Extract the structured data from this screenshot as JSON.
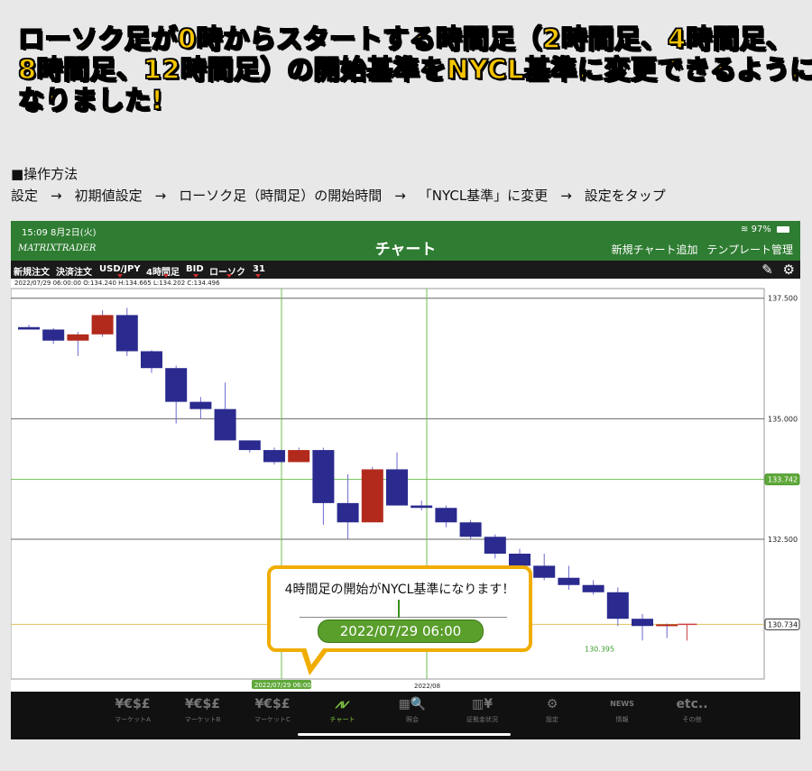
{
  "headline": {
    "line1": "ローソク足が0時からスタートする時間足（2時間足、4時間足、",
    "line2": "8時間足、12時間足）の開始基準をNYCL基準に変更できるように",
    "line3": "なりました!"
  },
  "ops": {
    "title": "■操作方法",
    "steps": [
      "設定",
      "初期値設定",
      "ローソク足（時間足）の開始時間",
      "「NYCL基準」に変更",
      "設定をタップ"
    ],
    "arrow": "→"
  },
  "statusbar": {
    "time": "15:09  8月2日(火)",
    "battery": "97%"
  },
  "navbar": {
    "logo": "MATRIXTRADER",
    "title": "チャート",
    "new_chart": "新規チャート追加",
    "template": "テンプレート管理"
  },
  "toolbar": {
    "new_order": "新規注文",
    "close_order": "決済注文",
    "pair": "USD/JPY",
    "timeframe": "4時間足",
    "side": "BID",
    "chart_type": "ローソク",
    "count": "31"
  },
  "ohlc": "2022/07/29 06:00:00   O:134.240  H:134.665  L:134.202  C:134.496",
  "chart_data": {
    "type": "candlestick",
    "ylim": [
      129.6,
      137.7
    ],
    "y_ticks": [
      137.5,
      135.0,
      132.5
    ],
    "y_tick_labels": [
      "137.500",
      "135.000",
      "132.500"
    ],
    "current_price": "130.734",
    "crosshair_price": "133.742",
    "low_label": "130.395",
    "x_labels": [
      "2022/07/29 06:00",
      "2022/08"
    ],
    "colors": {
      "up": "#b22a1c",
      "down": "#2a2a8f",
      "grid": "#666666",
      "cross": "#6fbf4f",
      "price_line": "#e0c060"
    },
    "candles": [
      {
        "o": 136.9,
        "h": 136.95,
        "l": 136.85,
        "c": 136.85
      },
      {
        "o": 136.85,
        "h": 136.88,
        "l": 136.55,
        "c": 136.62
      },
      {
        "o": 136.62,
        "h": 136.8,
        "l": 136.3,
        "c": 136.75
      },
      {
        "o": 136.75,
        "h": 137.25,
        "l": 136.7,
        "c": 137.15
      },
      {
        "o": 137.15,
        "h": 137.3,
        "l": 136.3,
        "c": 136.4
      },
      {
        "o": 136.4,
        "h": 136.42,
        "l": 135.95,
        "c": 136.05
      },
      {
        "o": 136.05,
        "h": 136.1,
        "l": 134.9,
        "c": 135.35
      },
      {
        "o": 135.35,
        "h": 135.45,
        "l": 135.0,
        "c": 135.2
      },
      {
        "o": 135.2,
        "h": 135.75,
        "l": 134.6,
        "c": 134.55
      },
      {
        "o": 134.55,
        "h": 134.55,
        "l": 134.3,
        "c": 134.35
      },
      {
        "o": 134.35,
        "h": 134.4,
        "l": 134.05,
        "c": 134.1
      },
      {
        "o": 134.1,
        "h": 134.4,
        "l": 134.1,
        "c": 134.35
      },
      {
        "o": 134.35,
        "h": 134.4,
        "l": 132.8,
        "c": 133.25
      },
      {
        "o": 133.25,
        "h": 133.85,
        "l": 132.5,
        "c": 132.85
      },
      {
        "o": 132.85,
        "h": 134.0,
        "l": 132.85,
        "c": 133.95
      },
      {
        "o": 133.95,
        "h": 134.3,
        "l": 133.2,
        "c": 133.2
      },
      {
        "o": 133.2,
        "h": 133.3,
        "l": 133.1,
        "c": 133.15
      },
      {
        "o": 133.15,
        "h": 133.2,
        "l": 132.75,
        "c": 132.85
      },
      {
        "o": 132.85,
        "h": 132.9,
        "l": 132.5,
        "c": 132.55
      },
      {
        "o": 132.55,
        "h": 132.6,
        "l": 132.1,
        "c": 132.2
      },
      {
        "o": 132.2,
        "h": 132.3,
        "l": 131.85,
        "c": 131.95
      },
      {
        "o": 131.95,
        "h": 132.2,
        "l": 131.65,
        "c": 131.7
      },
      {
        "o": 131.7,
        "h": 131.95,
        "l": 131.45,
        "c": 131.55
      },
      {
        "o": 131.55,
        "h": 131.65,
        "l": 131.35,
        "c": 131.4
      },
      {
        "o": 131.4,
        "h": 131.5,
        "l": 130.7,
        "c": 130.85
      },
      {
        "o": 130.85,
        "h": 130.95,
        "l": 130.4,
        "c": 130.7
      },
      {
        "o": 130.7,
        "h": 130.75,
        "l": 130.45,
        "c": 130.734
      }
    ]
  },
  "callout": {
    "message": "4時間足の開始がNYCL基準になります！",
    "date": "2022/07/29 06:00"
  },
  "tabs": [
    {
      "icon": "¥€$£",
      "label": "マーケットA"
    },
    {
      "icon": "¥€$£",
      "label": "マーケットB"
    },
    {
      "icon": "¥€$£",
      "label": "マーケットC"
    },
    {
      "icon": "⩘⩗",
      "label": "チャート"
    },
    {
      "icon": "▦🔍",
      "label": "照会"
    },
    {
      "icon": "▥¥",
      "label": "証拠金状況"
    },
    {
      "icon": "⚙",
      "label": "設定"
    },
    {
      "icon": "NEWS",
      "label": "情報"
    },
    {
      "icon": "etc..",
      "label": "その他"
    }
  ]
}
